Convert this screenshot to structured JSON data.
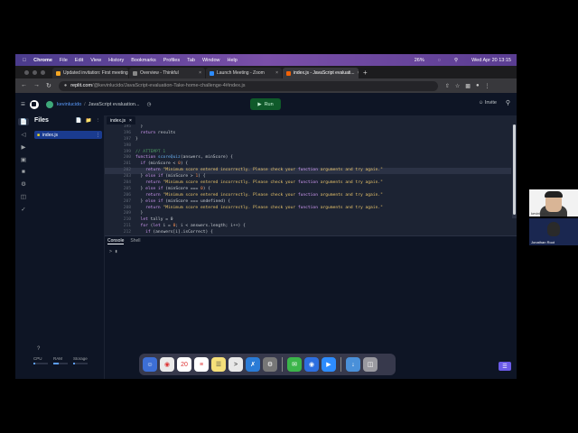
{
  "menubar": {
    "app": "Chrome",
    "items": [
      "File",
      "Edit",
      "View",
      "History",
      "Bookmarks",
      "Profiles",
      "Tab",
      "Window",
      "Help"
    ],
    "battery": "26%",
    "datetime": "Wed Apr 20  13:15"
  },
  "browser": {
    "tabs": [
      {
        "label": "Updated invitation: First meeting"
      },
      {
        "label": "Overview - Thinkful"
      },
      {
        "label": "Launch Meeting - Zoom"
      },
      {
        "label": "index.js - JavaScript evaluati..."
      }
    ],
    "url_host": "replit.com",
    "url_path": "/@kevinlucido/JavaScript-evaluation-Take-home-challenge-4#index.js"
  },
  "replit": {
    "user": "kevinlucido",
    "repl": "JavaScript evaluation...",
    "run_label": "Run",
    "invite_label": "Invite",
    "files_title": "Files",
    "file_name": "index.js",
    "editor_tab": "index.js",
    "resources": [
      {
        "label": "CPU",
        "value": 0.15
      },
      {
        "label": "RAM",
        "value": 0.35
      },
      {
        "label": "Storage",
        "value": 0.1
      }
    ],
    "console_tabs": [
      "Console",
      "Shell"
    ],
    "console_prompt": ">"
  },
  "code_lines": [
    {
      "n": "195",
      "t": "  }"
    },
    {
      "n": "196",
      "t": "  return results"
    },
    {
      "n": "197",
      "t": "}"
    },
    {
      "n": "198",
      "t": ""
    },
    {
      "n": "199",
      "t": "// ATTEMPT 1"
    },
    {
      "n": "200",
      "t": "function scoreQuiz(answers, minScore) {"
    },
    {
      "n": "201",
      "t": "  if (minScore < 0) {"
    },
    {
      "n": "202",
      "t": "    return \"Minimum score entered incorrectly. Please check your function arguments and try again.\""
    },
    {
      "n": "203",
      "t": "  } else if (minScore > 1) {"
    },
    {
      "n": "204",
      "t": "    return \"Minimum score entered incorrectly. Please check your function arguments and try again.\""
    },
    {
      "n": "205",
      "t": "  } else if (minScore === 0) {"
    },
    {
      "n": "206",
      "t": "    return \"Minimum score entered incorrectly. Please check your function arguments and try again.\""
    },
    {
      "n": "207",
      "t": "  } else if (minScore === undefined) {"
    },
    {
      "n": "208",
      "t": "    return \"Minimum score entered incorrectly. Please check your function arguments and try again.\""
    },
    {
      "n": "209",
      "t": "  }"
    },
    {
      "n": "210",
      "t": "  let tally = 0"
    },
    {
      "n": "211",
      "t": "  for (let i = 0; i < answers.length; i++) {"
    },
    {
      "n": "212",
      "t": "    if (answers[i].isCorrect) {"
    }
  ],
  "video": {
    "tile1_name": "Jonathan Root",
    "tile2_name": "kevinlucido"
  },
  "dock": {
    "calendar_day": "20"
  }
}
